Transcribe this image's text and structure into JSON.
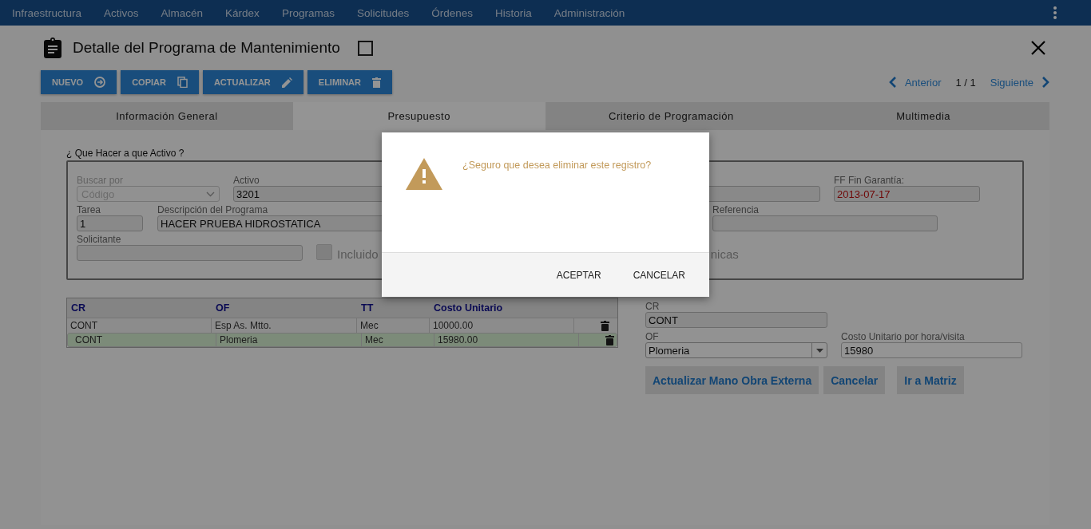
{
  "nav": {
    "items": [
      "Infraestructura",
      "Activos",
      "Almacén",
      "Kárdex",
      "Programas",
      "Solicitudes",
      "Órdenes",
      "Historia",
      "Administración"
    ]
  },
  "header": {
    "title": "Detalle del Programa de Mantenimiento",
    "checked": false
  },
  "toolbar": {
    "buttons": [
      {
        "label": "NUEVO",
        "kind": "add"
      },
      {
        "label": "COPIAR",
        "kind": "copy"
      },
      {
        "label": "ACTUALIZAR",
        "kind": "edit"
      },
      {
        "label": "ELIMINAR",
        "kind": "delete"
      }
    ]
  },
  "pager": {
    "previous": "Anterior",
    "position": "1 / 1",
    "next": "Siguiente"
  },
  "tabs": [
    {
      "label": "Información General",
      "selected": false
    },
    {
      "label": "Presupuesto",
      "selected": true
    },
    {
      "label": "Criterio de Programación",
      "selected": false
    },
    {
      "label": "Multimedia",
      "selected": false
    }
  ],
  "form": {
    "legend": "¿ Que Hacer a que Activo ?",
    "buscar": {
      "label": "Buscar por",
      "placeholder": "Código"
    },
    "activo": {
      "label": "Activo",
      "value": "3201"
    },
    "fin_garantia": {
      "label": "FF Fin Garantía:",
      "value": "2013-07-17"
    },
    "tarea": {
      "label": "Tarea",
      "value": "1"
    },
    "descripcion": {
      "label": "Descripción del Programa",
      "value": "HACER PRUEBA HIDROSTATICA"
    },
    "referencia": {
      "label": "Referencia"
    },
    "solicitante": {
      "label": "Solicitante"
    },
    "incluido": {
      "label": "Incluido",
      "checked": false
    },
    "cut_label": "nicas"
  },
  "table": {
    "columns": [
      "CR",
      "OF",
      "TT",
      "Costo Unitario"
    ],
    "rows": [
      {
        "cells": [
          "CONT",
          "Esp As. Mtto.",
          "Mec",
          "10000.00"
        ],
        "selected": false
      },
      {
        "cells": [
          "CONT",
          "Plomeria",
          "Mec",
          "15980.00"
        ],
        "selected": true
      }
    ]
  },
  "editor": {
    "cr": {
      "label": "CR",
      "value": "CONT"
    },
    "of": {
      "label": "OF",
      "value": "Plomeria"
    },
    "costo": {
      "label": "Costo Unitario por hora/visita",
      "value": "15980"
    },
    "buttons": [
      "Actualizar Mano Obra Externa",
      "Cancelar",
      "Ir a Matriz"
    ]
  },
  "dialog": {
    "message": "¿Seguro que desea eliminar este registro?",
    "buttons": [
      "ACEPTAR",
      "CANCELAR"
    ]
  }
}
